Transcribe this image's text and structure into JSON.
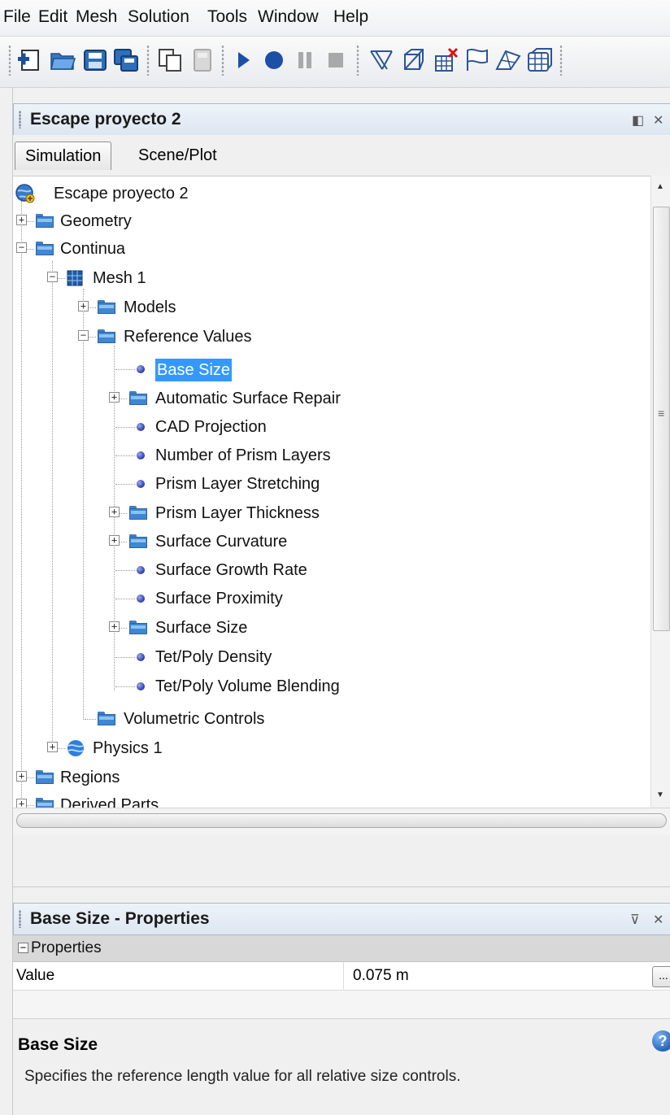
{
  "menubar": {
    "items": [
      "File",
      "Edit",
      "Mesh",
      "Solution",
      "Tools",
      "Window",
      "Help"
    ]
  },
  "toolbar": {
    "buttons": [
      {
        "icon": "new-simulation-icon"
      },
      {
        "icon": "open-folder-icon"
      },
      {
        "icon": "save-icon"
      },
      {
        "icon": "save-as-icon"
      },
      {
        "icon": "copy-icon"
      },
      {
        "icon": "disabled-document-icon"
      },
      {
        "icon": "run-icon"
      },
      {
        "icon": "step-icon"
      },
      {
        "icon": "pause-icon"
      },
      {
        "icon": "stop-icon"
      },
      {
        "icon": "mesh-tool-icon"
      },
      {
        "icon": "clear-mesh-icon"
      },
      {
        "icon": "delete-mesh-icon"
      },
      {
        "icon": "flag-icon"
      },
      {
        "icon": "surface-icon"
      },
      {
        "icon": "volume-mesh-icon"
      }
    ]
  },
  "explorer": {
    "title": "Escape proyecto 2",
    "tabs": [
      {
        "label": "Simulation",
        "active": true
      },
      {
        "label": "Scene/Plot",
        "active": false
      }
    ],
    "tree": [
      {
        "label": "Escape proyecto 2",
        "icon": "simulation-globe-icon",
        "level": 0,
        "expander": "none"
      },
      {
        "label": "Geometry",
        "icon": "folder-icon",
        "level": 0,
        "expander": "plus"
      },
      {
        "label": "Continua",
        "icon": "folder-icon",
        "level": 0,
        "expander": "minus"
      },
      {
        "label": "Mesh 1",
        "icon": "mesh-grid-icon",
        "level": 1,
        "expander": "minus"
      },
      {
        "label": "Models",
        "icon": "folder-icon",
        "level": 2,
        "expander": "plus"
      },
      {
        "label": "Reference Values",
        "icon": "folder-icon",
        "level": 2,
        "expander": "minus"
      },
      {
        "label": "Base Size",
        "icon": "value-dot-icon",
        "level": 3,
        "expander": "none",
        "selected": true
      },
      {
        "label": "Automatic Surface Repair",
        "icon": "folder-icon",
        "level": 3,
        "expander": "plus"
      },
      {
        "label": "CAD Projection",
        "icon": "value-dot-icon",
        "level": 3,
        "expander": "none"
      },
      {
        "label": "Number of Prism Layers",
        "icon": "value-dot-icon",
        "level": 3,
        "expander": "none"
      },
      {
        "label": "Prism Layer Stretching",
        "icon": "value-dot-icon",
        "level": 3,
        "expander": "none"
      },
      {
        "label": "Prism Layer Thickness",
        "icon": "folder-icon",
        "level": 3,
        "expander": "plus"
      },
      {
        "label": "Surface Curvature",
        "icon": "folder-icon",
        "level": 3,
        "expander": "plus"
      },
      {
        "label": "Surface Growth Rate",
        "icon": "value-dot-icon",
        "level": 3,
        "expander": "none"
      },
      {
        "label": "Surface Proximity",
        "icon": "value-dot-icon",
        "level": 3,
        "expander": "none"
      },
      {
        "label": "Surface Size",
        "icon": "folder-icon",
        "level": 3,
        "expander": "plus"
      },
      {
        "label": "Tet/Poly Density",
        "icon": "value-dot-icon",
        "level": 3,
        "expander": "none"
      },
      {
        "label": "Tet/Poly Volume Blending",
        "icon": "value-dot-icon",
        "level": 3,
        "expander": "none"
      },
      {
        "label": "Volumetric Controls",
        "icon": "folder-icon",
        "level": 2,
        "expander": "none"
      },
      {
        "label": "Physics 1",
        "icon": "physics-sphere-icon",
        "level": 1,
        "expander": "plus"
      },
      {
        "label": "Regions",
        "icon": "folder-icon",
        "level": 0,
        "expander": "plus"
      },
      {
        "label": "Derived Parts",
        "icon": "folder-icon",
        "level": 0,
        "expander": "plus"
      }
    ]
  },
  "properties": {
    "title": "Base Size - Properties",
    "section_label": "Properties",
    "rows": [
      {
        "name": "Value",
        "value": "0.075 m"
      }
    ],
    "ellipsis_label": "...",
    "description_title": "Base Size",
    "description_text": "Specifies the reference length value for all relative size controls.",
    "help_glyph": "?"
  },
  "colors": {
    "selection": "#3399ff",
    "folder": "#3f86d3",
    "header_bg": "#dde6f1"
  }
}
